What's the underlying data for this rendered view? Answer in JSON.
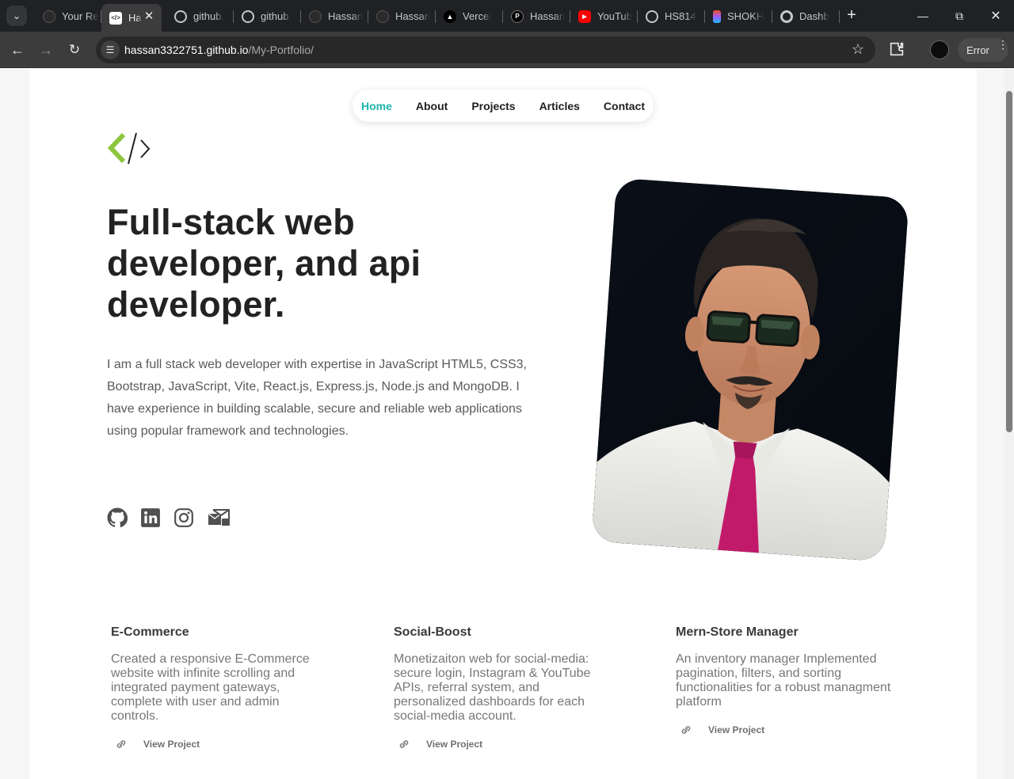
{
  "browser": {
    "tabs": [
      {
        "title": "Your Re",
        "icon": "github-icon",
        "active": false
      },
      {
        "title": "Ha",
        "icon": "code-icon",
        "active": true
      },
      {
        "title": "github.",
        "icon": "globe-icon",
        "active": false
      },
      {
        "title": "github.",
        "icon": "globe-icon",
        "active": false
      },
      {
        "title": "Hassan",
        "icon": "github-icon",
        "active": false
      },
      {
        "title": "Hassan",
        "icon": "github-icon",
        "active": false
      },
      {
        "title": "Vercel",
        "icon": "vercel-icon",
        "active": false
      },
      {
        "title": "Hassan",
        "icon": "profile-icon",
        "active": false
      },
      {
        "title": "YouTub",
        "icon": "youtube-icon",
        "active": false
      },
      {
        "title": "HS814",
        "icon": "globe-icon",
        "active": false
      },
      {
        "title": "SHOKH",
        "icon": "figma-icon",
        "active": false
      },
      {
        "title": "Dashb",
        "icon": "chrome-icon",
        "active": false
      }
    ],
    "url_host": "hassan3322751.github.io",
    "url_path": "/My-Portfolio/",
    "error_label": "Error"
  },
  "nav": {
    "items": [
      "Home",
      "About",
      "Projects",
      "Articles",
      "Contact"
    ],
    "active": "Home"
  },
  "hero": {
    "title": "Full-stack web developer, and api developer.",
    "description": "I am a full stack web developer with expertise in JavaScript HTML5, CSS3, Bootstrap, JavaScript, Vite, React.js, Express.js, Node.js and MongoDB. I have experience in building scalable, secure and reliable web applications using popular framework and technologies."
  },
  "socials": [
    "github-icon",
    "linkedin-icon",
    "instagram-icon",
    "email-icon"
  ],
  "projects": [
    {
      "title": "E-Commerce",
      "description": "Created a responsive E-Commerce website with infinite scrolling and integrated payment gateways, complete with user and admin controls.",
      "link_label": "View Project"
    },
    {
      "title": "Social-Boost",
      "description": "Monetizaiton web for social-media: secure login, Instagram & YouTube APIs, referral system, and personalized dashboards for each social-media account.",
      "link_label": "View Project"
    },
    {
      "title": "Mern-Store Manager",
      "description": "An inventory manager Implemented pagination, filters, and sorting functionalities for a robust managment platform",
      "link_label": "View Project"
    }
  ],
  "colors": {
    "accent": "#1fb5ad",
    "logo_green": "#8dc63f",
    "heading": "#222222",
    "body_text": "#5a5a5a"
  }
}
